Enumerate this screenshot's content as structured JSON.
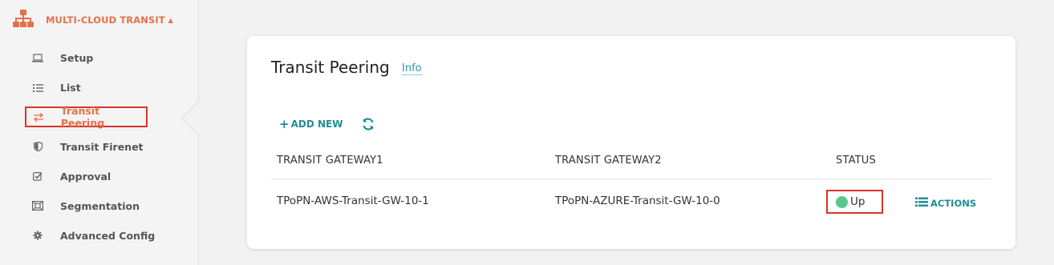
{
  "sidebar": {
    "section_title": "MULTI-CLOUD TRANSIT",
    "section_icon": "sitemap-icon",
    "items": [
      {
        "label": "Setup",
        "icon": "laptop-icon"
      },
      {
        "label": "List",
        "icon": "list-icon"
      },
      {
        "label": "Transit Peering",
        "icon": "exchange-icon",
        "active": true
      },
      {
        "label": "Transit Firenet",
        "icon": "shield-icon"
      },
      {
        "label": "Approval",
        "icon": "check-square-icon"
      },
      {
        "label": "Segmentation",
        "icon": "segment-icon"
      },
      {
        "label": "Advanced Config",
        "icon": "gear-icon"
      }
    ]
  },
  "main": {
    "title": "Transit Peering",
    "info_link": "Info",
    "toolbar": {
      "add_new_label": "ADD NEW",
      "refresh_icon": "refresh-icon"
    },
    "table": {
      "headers": [
        "TRANSIT GATEWAY1",
        "TRANSIT GATEWAY2",
        "STATUS"
      ],
      "rows": [
        {
          "gateway1": "TPoPN-AWS-Transit-GW-10-1",
          "gateway2": "TPoPN-AZURE-Transit-GW-10-0",
          "status": "Up",
          "actions_label": "ACTIONS"
        }
      ]
    }
  },
  "colors": {
    "accent_orange": "#e5714a",
    "teal": "#1f8f94",
    "status_up": "#5cc68a",
    "highlight_red": "#d9342b"
  }
}
